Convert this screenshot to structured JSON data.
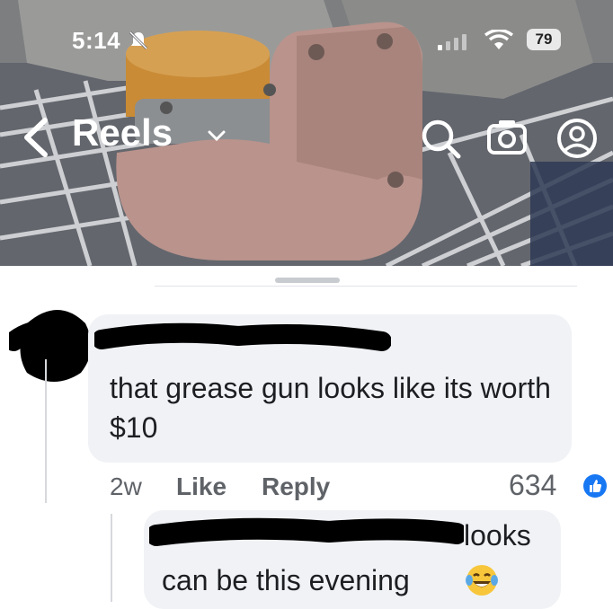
{
  "status_bar": {
    "time": "5:14",
    "battery": "79",
    "icons": [
      "bell-muted-icon",
      "signal-icon",
      "wifi-icon",
      "battery-icon"
    ]
  },
  "nav": {
    "title": "Reels",
    "icons": [
      "back-chevron-icon",
      "dropdown-chevron-icon",
      "search-icon",
      "camera-icon",
      "profile-icon"
    ]
  },
  "comment": {
    "text": "that grease gun looks like its worth $10",
    "time": "2w",
    "like_label": "Like",
    "reply_label": "Reply",
    "like_count": "634"
  },
  "reply": {
    "line1": "looks",
    "line2": "can be this evening",
    "emoji": "laughing-crying-emoji"
  },
  "colors": {
    "bubble": "#f0f2f5",
    "text": "#1c1e21",
    "meta": "#5f6368",
    "like_blue": "#1877f2"
  }
}
